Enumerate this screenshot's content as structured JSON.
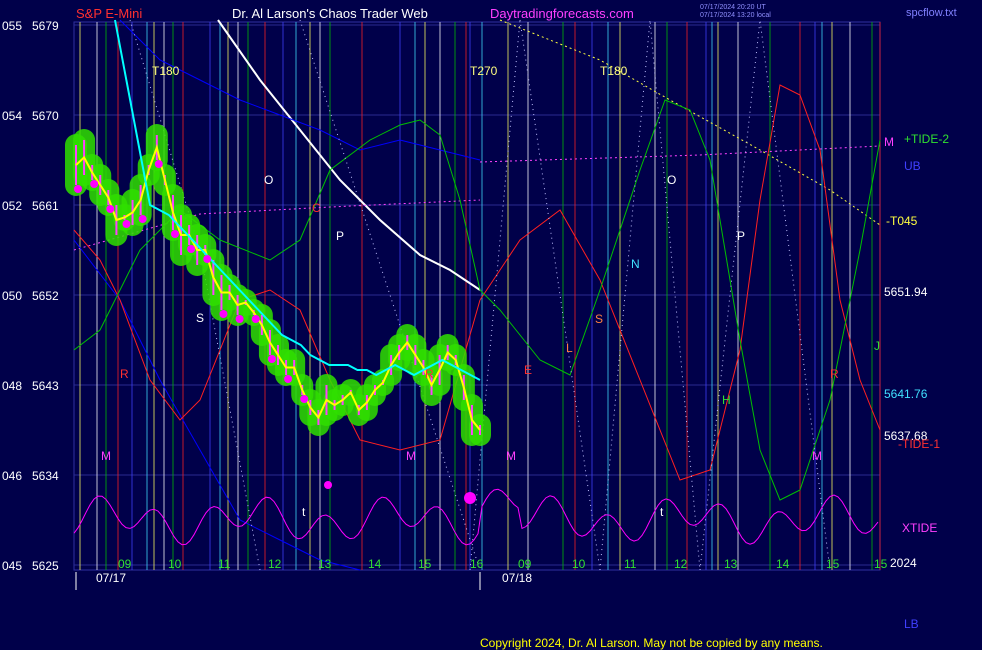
{
  "header": {
    "instrument": "S&P E-Mini",
    "title": "Dr. Al Larson's Chaos Trader Web",
    "site": "Daytradingforecasts.com",
    "utc_stamp": "07/17/2024 20:20 UT",
    "local_stamp": "07/17/2024 13:20 local",
    "file": "spcflow.txt"
  },
  "colors": {
    "background": "#00004a",
    "price_yellow": "#ffff00",
    "flow_cyan": "#00ffff",
    "bands_green": "#30e000",
    "dots_magenta": "#ff00ff",
    "white_line": "#ffffff",
    "red_line": "#ff2020",
    "green_line": "#00c000",
    "blue_line": "#0000ff",
    "xtide": "#ff00ff"
  },
  "chart_data": {
    "type": "line",
    "title": "S&P E-Mini",
    "y_axis_left_labels": [
      {
        "code": "055",
        "price": "5679"
      },
      {
        "code": "054",
        "price": "5670"
      },
      {
        "code": "052",
        "price": "5661"
      },
      {
        "code": "050",
        "price": "5652"
      },
      {
        "code": "048",
        "price": "5643"
      },
      {
        "code": "046",
        "price": "5634"
      },
      {
        "code": "045",
        "price": "5625"
      }
    ],
    "ylim": [
      5625,
      5679
    ],
    "x_hour_labels": [
      "09",
      "10",
      "11",
      "12",
      "13",
      "14",
      "15",
      "16",
      "09",
      "10",
      "11",
      "12",
      "13",
      "14",
      "15",
      "15"
    ],
    "date_labels": [
      "07/17",
      "07/18"
    ],
    "year_label": "2024",
    "right_labels": {
      "tide2": "+TIDE-2",
      "ub": "UB",
      "t045": "-T045",
      "price1": "5651.94",
      "price2": "5641.76",
      "price3": "5637.68",
      "tide1": "-TIDE-1",
      "xtide": "XTIDE",
      "lb": "LB",
      "m_top": "M"
    },
    "markers": [
      "T180",
      "T270",
      "T180",
      "O",
      "P",
      "O",
      "P",
      "N",
      "S",
      "R",
      "R",
      "R",
      "M",
      "M",
      "M",
      "M",
      "H",
      "J",
      "t",
      "t",
      "C",
      "S",
      "E",
      "L"
    ],
    "price_series": [
      [
        5667,
        5663
      ],
      [
        5667.5,
        5664
      ],
      [
        5665,
        5663.5
      ],
      [
        5664,
        5662
      ],
      [
        5662.5,
        5661
      ],
      [
        5661,
        5658
      ],
      [
        5660,
        5659.5
      ],
      [
        5661.5,
        5659
      ],
      [
        5663,
        5660
      ],
      [
        5664,
        5665
      ],
      [
        5665.5,
        5668
      ],
      [
        5664,
        5663
      ],
      [
        5662,
        5658.5
      ],
      [
        5660,
        5656
      ],
      [
        5659,
        5657
      ],
      [
        5658,
        5655
      ],
      [
        5657,
        5656
      ],
      [
        5655.5,
        5652
      ],
      [
        5654,
        5650.5
      ],
      [
        5653,
        5651.5
      ],
      [
        5652,
        5650
      ],
      [
        5651,
        5651.5
      ],
      [
        5650.5,
        5650
      ],
      [
        5650,
        5648
      ],
      [
        5648.5,
        5646
      ],
      [
        5647,
        5645
      ],
      [
        5645.5,
        5644
      ],
      [
        5644,
        5645.5
      ],
      [
        5643,
        5642
      ],
      [
        5641.5,
        5640
      ],
      [
        5640.5,
        5639
      ],
      [
        5640,
        5643
      ],
      [
        5641.5,
        5640.5
      ],
      [
        5641,
        5642
      ],
      [
        5642,
        5642.5
      ],
      [
        5641,
        5640
      ],
      [
        5640.5,
        5642
      ],
      [
        5642,
        5643
      ],
      [
        5643,
        5643.5
      ],
      [
        5644,
        5646
      ],
      [
        5645.5,
        5647
      ],
      [
        5646.5,
        5648
      ],
      [
        5647,
        5645
      ],
      [
        5645.5,
        5644
      ],
      [
        5644,
        5642
      ],
      [
        5643,
        5646
      ],
      [
        5645.5,
        5647
      ],
      [
        5646,
        5645
      ],
      [
        5644,
        5641.5
      ],
      [
        5641,
        5638
      ],
      [
        5638,
        5639
      ]
    ],
    "flow_series": [
      5661,
      5660.5,
      5660,
      5659,
      5658,
      5657,
      5656,
      5655,
      5654,
      5653,
      5652,
      5651,
      5650,
      5649,
      5648,
      5647.5,
      5647,
      5646,
      5645.5,
      5645,
      5645,
      5645,
      5644.5,
      5644.5,
      5644,
      5644.5,
      5645,
      5644.5,
      5644,
      5644.5,
      5645,
      5645.5,
      5645,
      5644.5,
      5644,
      5643.5
    ],
    "copyright": "Copyright 2024, Dr. Al Larson. May not be copied by any means."
  }
}
